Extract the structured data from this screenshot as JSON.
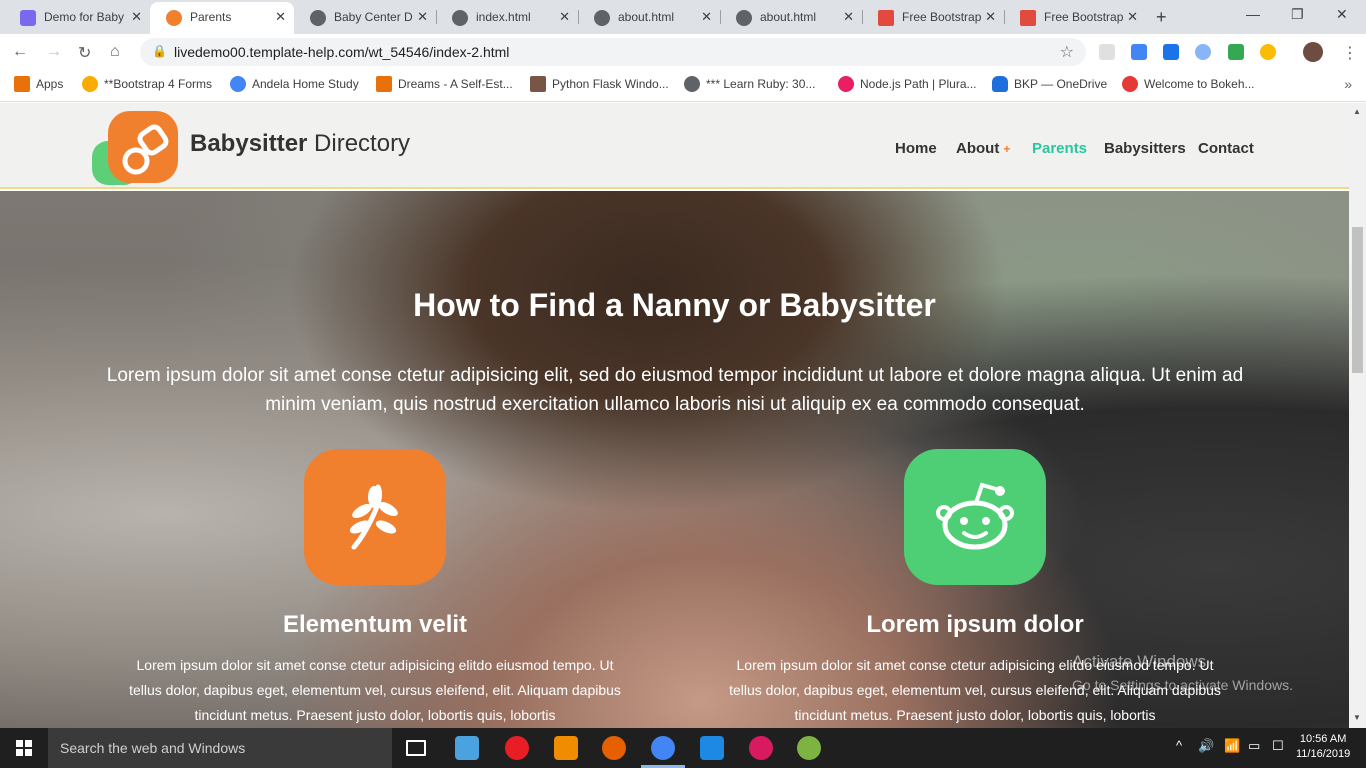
{
  "browser": {
    "tabs": [
      {
        "title": "Demo for Baby",
        "active": false,
        "fav_color": "#7b68ee"
      },
      {
        "title": "Parents",
        "active": true,
        "fav_color": "#f07f2e"
      },
      {
        "title": "Baby Center D",
        "active": false,
        "fav_color": "#5f6368"
      },
      {
        "title": "index.html",
        "active": false,
        "fav_color": "#5f6368"
      },
      {
        "title": "about.html",
        "active": false,
        "fav_color": "#5f6368"
      },
      {
        "title": "about.html",
        "active": false,
        "fav_color": "#5f6368"
      },
      {
        "title": "Free Bootstrap",
        "active": false,
        "fav_color": "#e04a3f"
      },
      {
        "title": "Free Bootstrap",
        "active": false,
        "fav_color": "#e04a3f"
      }
    ],
    "url": "livedemo00.template-help.com/wt_54546/index-2.html",
    "bookmarks": [
      {
        "label": "Apps",
        "color": "#e8710a"
      },
      {
        "label": "**Bootstrap 4 Forms",
        "color": "#f9ab00"
      },
      {
        "label": "Andela Home Study",
        "color": "#4285f4"
      },
      {
        "label": "Dreams - A Self-Est...",
        "color": "#e8710a"
      },
      {
        "label": "Python Flask Windo...",
        "color": "#795548"
      },
      {
        "label": "*** Learn Ruby: 30...",
        "color": "#5f6368"
      },
      {
        "label": "Node.js Path | Plura...",
        "color": "#e91e63"
      },
      {
        "label": "BKP — OneDrive",
        "color": "#1e6fd9"
      },
      {
        "label": "Welcome to Bokeh...",
        "color": "#e53935"
      }
    ]
  },
  "site": {
    "brand_bold": "Babysitter",
    "brand_light": "Directory",
    "nav": [
      {
        "label": "Home",
        "active": false
      },
      {
        "label": "About",
        "active": false,
        "has_plus": true,
        "plus": "+"
      },
      {
        "label": "Parents",
        "active": true
      },
      {
        "label": "Babysitters",
        "active": false
      },
      {
        "label": "Contact",
        "active": false
      }
    ],
    "hero": {
      "title": "How to Find a Nanny or Babysitter",
      "text": "Lorem ipsum dolor sit amet conse ctetur adipisicing elit, sed do eiusmod tempor incididunt ut labore et dolore magna aliqua. Ut enim ad minim veniam, quis nostrud exercitation ullamco laboris nisi ut aliquip ex ea commodo consequat."
    },
    "features": [
      {
        "title": "Elementum velit",
        "icon": "leaf-icon",
        "color": "#f07f2e",
        "text": "Lorem ipsum dolor sit amet conse ctetur adipisicing elitdo eiusmod tempo. Ut tellus dolor, dapibus eget, elementum vel, cursus eleifend, elit. Aliquam dapibus tincidunt metus. Praesent justo dolor, lobortis quis, lobortis"
      },
      {
        "title": "Lorem ipsum dolor",
        "icon": "reddit-icon",
        "color": "#4fcf75",
        "text": "Lorem ipsum dolor sit amet conse ctetur adipisicing elitdo eiusmod tempo. Ut tellus dolor, dapibus eget, elementum vel, cursus eleifend, elit. Aliquam dapibus tincidunt metus. Praesent justo dolor, lobortis quis, lobortis"
      }
    ],
    "watermark_line1": "Activate Windows",
    "watermark_line2": "Go to Settings to activate Windows."
  },
  "taskbar": {
    "search_placeholder": "Search the web and Windows",
    "time": "10:56 AM",
    "date": "11/16/2019"
  }
}
